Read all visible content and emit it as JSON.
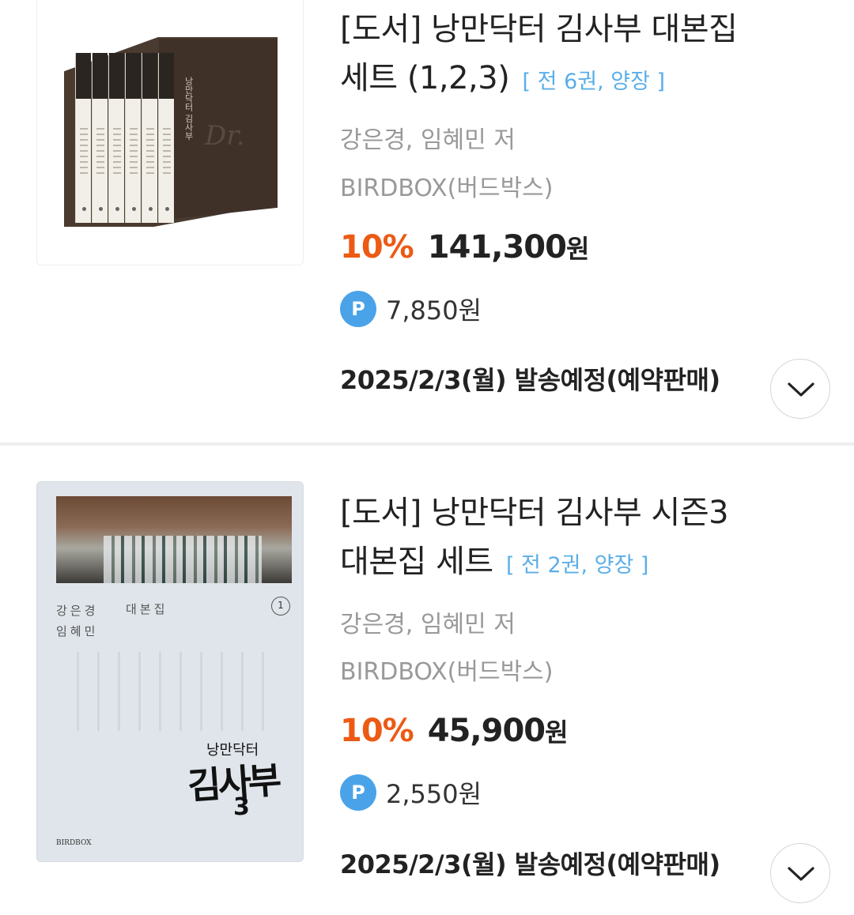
{
  "products": [
    {
      "title_line1": "[도서] 낭만닥터 김사부 대본집",
      "title_line2": "세트 (1,2,3)",
      "volume_info": "[ 전 6권, 양장 ]",
      "authors": "강은경, 임혜민 저",
      "publisher": "BIRDBOX(버드박스)",
      "discount": "10%",
      "price": "141,300",
      "price_unit": "원",
      "point_badge": "P",
      "points": "7,850원",
      "shipping": "2025/2/3(월) 발송예정(예약판매)",
      "cover_side_text": "낭만닥터 김사부",
      "cover_side_sig": "Dr."
    },
    {
      "title_line1": "[도서] 낭만닥터 김사부 시즌3",
      "title_line2": "대본집 세트",
      "volume_info": "[ 전 2권, 양장 ]",
      "authors": "강은경, 임혜민 저",
      "publisher": "BIRDBOX(버드박스)",
      "discount": "10%",
      "price": "45,900",
      "price_unit": "원",
      "point_badge": "P",
      "points": "2,550원",
      "shipping": "2025/2/3(월) 발송예정(예약판매)",
      "cover_authors_1": "강은경",
      "cover_authors_2": "임혜민",
      "cover_label": "대본집",
      "cover_volume_num": "1",
      "cover_logo_small": "낭만닥터",
      "cover_logo": "김사부",
      "cover_logo_num": "3",
      "cover_publisher": "BIRDBOX"
    }
  ],
  "icons": {
    "expand": "chevron-down-icon",
    "point": "point-badge-icon"
  },
  "colors": {
    "discount": "#ec5a14",
    "volume_info": "#5aaee8",
    "point_badge": "#4aa3e8",
    "meta_text": "#999999"
  }
}
